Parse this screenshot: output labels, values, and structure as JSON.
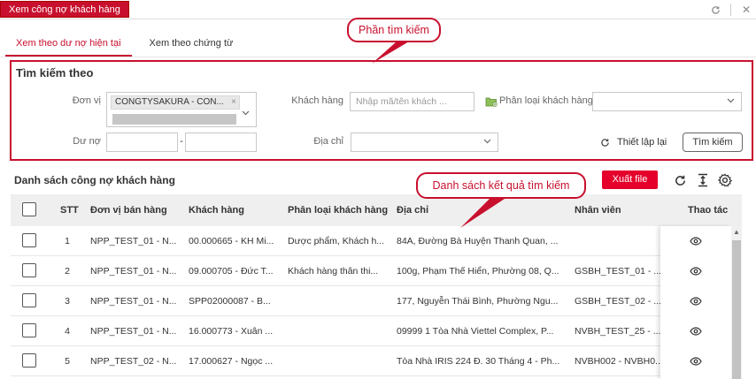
{
  "top_tab": "Xem công nợ khách hàng",
  "tabs": [
    "Xem theo dư nợ hiện tại",
    "Xem theo chứng từ"
  ],
  "callouts": {
    "search": "Phần tìm kiếm",
    "results": "Danh sách kết quả tìm kiếm"
  },
  "search": {
    "title": "Tìm kiếm theo",
    "don_vi_label": "Đơn vị",
    "don_vi_tag": "CONGTYSAKURA - CON...",
    "khach_hang_label": "Khách hàng",
    "khach_hang_placeholder": "Nhập mã/tên khách ...",
    "phan_loai_label": "Phân loại khách hàng",
    "du_no_label": "Dư nợ",
    "du_no_sep": "-",
    "dia_chi_label": "Địa chỉ",
    "reset_label": "Thiết lập lại",
    "search_button": "Tìm kiếm"
  },
  "list": {
    "title": "Danh sách công nợ khách hàng",
    "export_button": "Xuất file",
    "columns": [
      "STT",
      "Đơn vị bán hàng",
      "Khách hàng",
      "Phân loại khách hàng",
      "Địa chỉ",
      "Nhân viên",
      "Thao tác"
    ],
    "rows": [
      {
        "stt": "1",
        "don_vi": "NPP_TEST_01 - N...",
        "khach_hang": "00.000665 - KH Mi...",
        "phan_loai": "Dược phẩm, Khách h...",
        "dia_chi": "84A, Đường Bà Huyện Thanh Quan, ...",
        "nhan_vien": ""
      },
      {
        "stt": "2",
        "don_vi": "NPP_TEST_01 - N...",
        "khach_hang": "09.000705 - Đức T...",
        "phan_loai": "Khách hàng thân thi...",
        "dia_chi": "100g, Phạm Thế Hiển, Phường 08, Q...",
        "nhan_vien": "GSBH_TEST_01 - ..."
      },
      {
        "stt": "3",
        "don_vi": "NPP_TEST_01 - N...",
        "khach_hang": "SPP02000087 - B...",
        "phan_loai": "",
        "dia_chi": "177, Nguyễn Thái Bình, Phường Ngu...",
        "nhan_vien": "GSBH_TEST_02 - ..."
      },
      {
        "stt": "4",
        "don_vi": "NPP_TEST_01 - N...",
        "khach_hang": "16.000773 - Xuân ...",
        "phan_loai": "",
        "dia_chi": "09999 1 Tòa Nhà Viettel Complex, P...",
        "nhan_vien": "NVBH_TEST_25 - ..."
      },
      {
        "stt": "5",
        "don_vi": "NPP_TEST_02 - N...",
        "khach_hang": "17.000627 - Ngọc ...",
        "phan_loai": "",
        "dia_chi": "Tòa Nhà IRIS 224 Đ. 30 Tháng 4 - Ph...",
        "nhan_vien": "NVBH002 - NVBH0..."
      }
    ]
  },
  "colors": {
    "accent": "#c8102e",
    "export": "#e4002b"
  }
}
